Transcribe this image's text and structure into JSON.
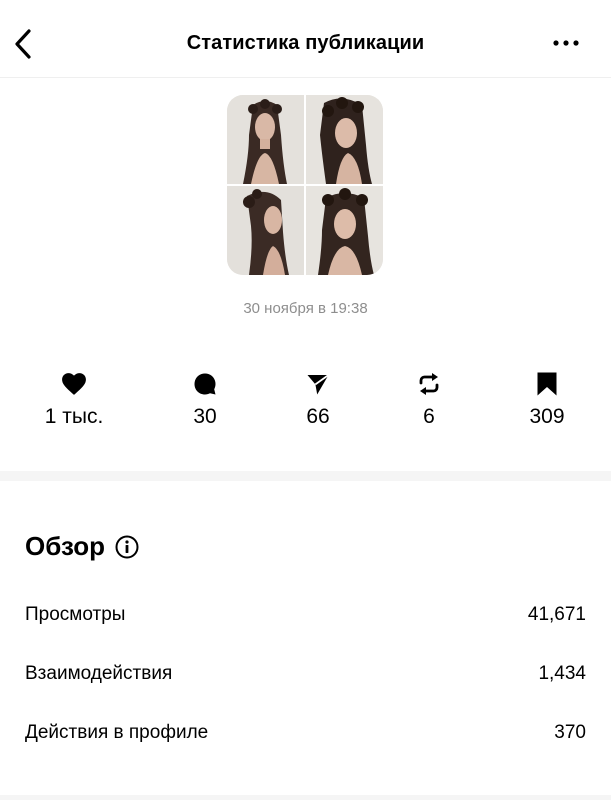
{
  "header": {
    "title": "Статистика публикации",
    "back_icon": "chevron-left-icon",
    "more_icon": "more-horizontal-icon"
  },
  "post": {
    "thumbnail_description_icon": "photo-grid-thumbnail",
    "date": "30 ноября в 19:38"
  },
  "metrics": [
    {
      "icon": "heart-icon",
      "value": "1 тыс."
    },
    {
      "icon": "comment-icon",
      "value": "30"
    },
    {
      "icon": "send-icon",
      "value": "66"
    },
    {
      "icon": "repost-icon",
      "value": "6"
    },
    {
      "icon": "bookmark-icon",
      "value": "309"
    }
  ],
  "overview": {
    "title": "Обзор",
    "info_icon": "info-icon",
    "rows": [
      {
        "label": "Просмотры",
        "value": "41,671"
      },
      {
        "label": "Взаимодействия",
        "value": "1,434"
      },
      {
        "label": "Действия в профиле",
        "value": "370"
      }
    ]
  },
  "colors": {
    "text": "#000000",
    "secondary_text": "#8e8e8e",
    "divider": "#f5f5f5",
    "background": "#ffffff"
  }
}
